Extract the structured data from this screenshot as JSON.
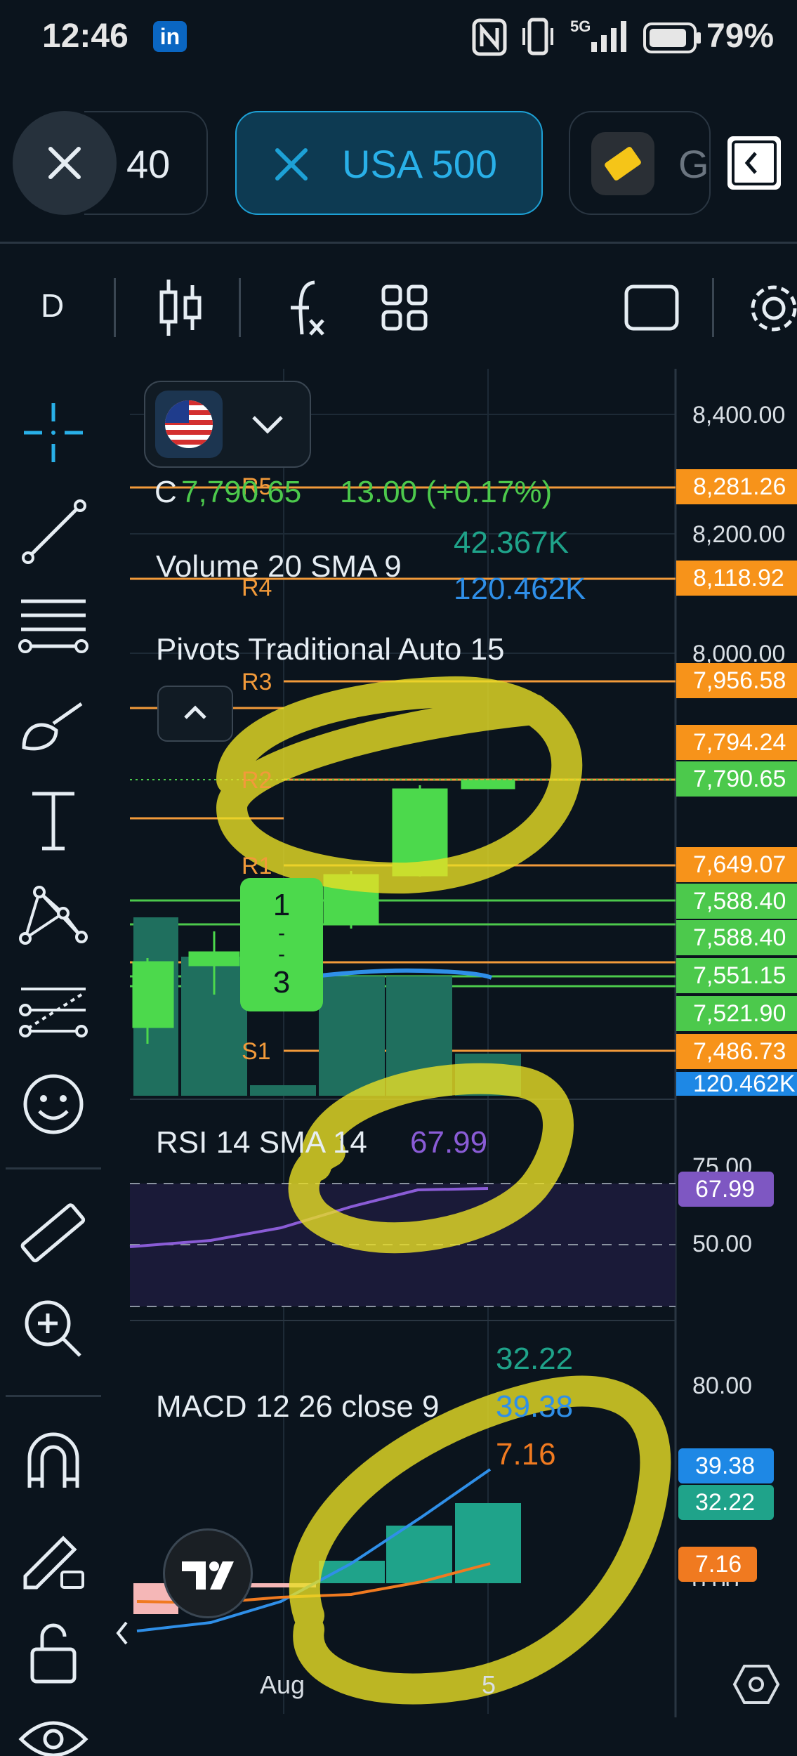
{
  "status_bar": {
    "time": "12:46",
    "network": "5G",
    "battery_percent": "79%",
    "linkedin_badge": "in"
  },
  "tabs": [
    {
      "label": "40",
      "active": false
    },
    {
      "label": "USA 500",
      "active": true
    },
    {
      "label": "G",
      "active": false
    }
  ],
  "toolbar": {
    "interval": "D"
  },
  "legend": {
    "close_prefix": "C",
    "close_value": "7,790.65",
    "change": "13.00 (+0.17%)",
    "volume_label": "Volume 20 SMA 9",
    "volume_value_1": "42.367K",
    "volume_value_2": "120.462K",
    "pivots_label": "Pivots Traditional Auto 15",
    "rsi_label": "RSI 14 SMA 14",
    "rsi_value": "67.99",
    "macd_label": "MACD 12 26 close 9",
    "macd_value_1": "32.22",
    "macd_value_2": "39.38",
    "macd_value_3": "7.16"
  },
  "pivot_levels": {
    "r5": "R5",
    "r4": "R4",
    "r3": "R3",
    "r2": "R2",
    "r1": "R1",
    "s1": "S1"
  },
  "price_axis": {
    "p1": "8,400.00",
    "p2": "8,200.00",
    "p3": "8,000.00"
  },
  "price_tags": [
    {
      "value": "8,281.26",
      "color": "#f7931a"
    },
    {
      "value": "8,118.92",
      "color": "#f7931a"
    },
    {
      "value": "7,956.58",
      "color": "#f7931a"
    },
    {
      "value": "7,794.24",
      "color": "#f7931a"
    },
    {
      "value": "7,790.65",
      "color": "#4cc94c"
    },
    {
      "value": "7,649.07",
      "color": "#f7931a"
    },
    {
      "value": "7,588.40",
      "color": "#4cc94c"
    },
    {
      "value": "7,588.40",
      "color": "#4cc94c"
    },
    {
      "value": "7,551.15",
      "color": "#4cc94c"
    },
    {
      "value": "7,521.90",
      "color": "#4cc94c"
    },
    {
      "value": "7,486.73",
      "color": "#f7931a"
    },
    {
      "value": "120.462K",
      "color": "#1e88e5"
    }
  ],
  "rsi_axis": {
    "p1": "75.00",
    "p2": "50.00",
    "tag": "67.99"
  },
  "macd_axis": {
    "p1": "80.00",
    "p2": "0.00",
    "tag1": "39.38",
    "tag2": "32.22",
    "tag3": "7.16"
  },
  "time_axis": {
    "t1": "Aug",
    "t2": "5"
  },
  "badge_counter": {
    "top": "1",
    "bottom": "3"
  },
  "colors": {
    "accent": "#1da1d6",
    "bull": "#4cd94c",
    "pivot": "#f29a3a",
    "rsi": "#8a5cd6",
    "macd": "#2f8fe8",
    "signal": "#f07a20",
    "hist": "#1fa38a"
  }
}
